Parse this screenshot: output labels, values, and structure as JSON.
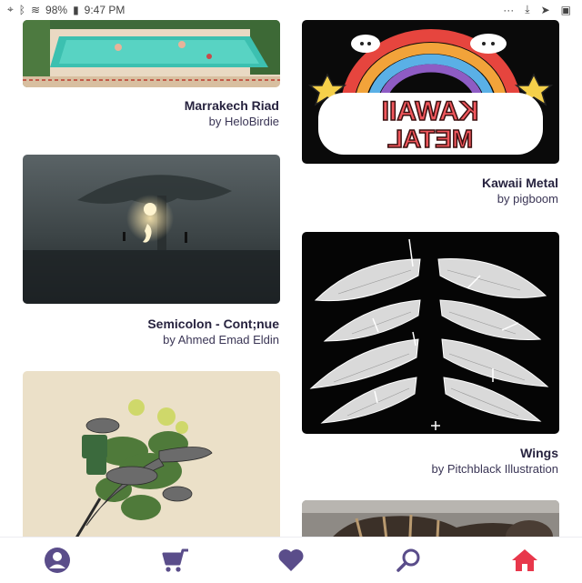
{
  "status": {
    "time": "9:47 PM",
    "battery": "98%",
    "overflow": "···"
  },
  "colors": {
    "nav_active": "#e8374b",
    "nav_inactive": "#5a4d8a",
    "title": "#27233f"
  },
  "artworks": [
    {
      "title": "Marrakech Riad",
      "author": "by HeloBirdie"
    },
    {
      "title": "Kawaii Metal",
      "author": "by pigboom",
      "art_text_top": "KAWAII",
      "art_text_bottom": "METAL"
    },
    {
      "title": "Semicolon - Cont;nue",
      "author": "by Ahmed Emad Eldin"
    },
    {
      "title": "Wings",
      "author": "by Pitchblack Illustration"
    },
    {
      "title": "",
      "author": ""
    },
    {
      "title": "",
      "author": ""
    }
  ],
  "bottom_nav": [
    {
      "icon": "profile-icon",
      "active": false
    },
    {
      "icon": "cart-icon",
      "active": false
    },
    {
      "icon": "heart-icon",
      "active": false
    },
    {
      "icon": "search-icon",
      "active": false
    },
    {
      "icon": "home-icon",
      "active": true
    }
  ]
}
